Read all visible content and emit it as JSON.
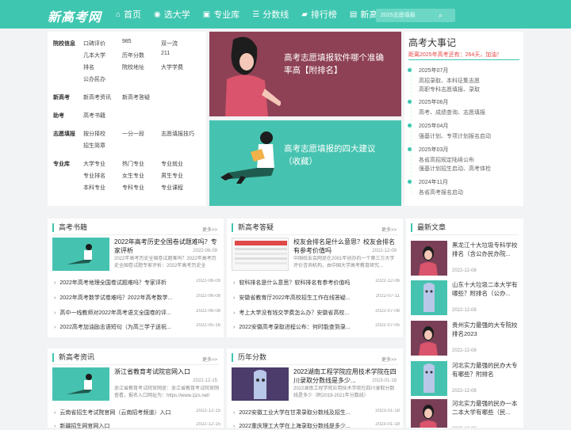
{
  "header": {
    "logo": "新高考网",
    "nav": [
      {
        "label": "首页",
        "icon": "home-icon",
        "glyph": "⌂"
      },
      {
        "label": "选大学",
        "icon": "compass-icon",
        "glyph": "◉"
      },
      {
        "label": "专业库",
        "icon": "briefcase-icon",
        "glyph": "▣"
      },
      {
        "label": "分数线",
        "icon": "list-icon",
        "glyph": "☰"
      },
      {
        "label": "排行榜",
        "icon": "chat-icon",
        "glyph": "▰"
      },
      {
        "label": "新高考资讯",
        "icon": "news-icon",
        "glyph": "▤"
      }
    ],
    "search_placeholder": "2025志愿填报",
    "accent": "#3ec6b0"
  },
  "categories": {
    "school_info": {
      "title": "院校信息",
      "items": [
        "口碑评价",
        "985",
        "双一流",
        "几本大学",
        "历年分数",
        "211",
        "排名",
        "院校地址",
        "大学学费",
        "公办民办"
      ]
    },
    "new_gaokao": {
      "title": "新高考",
      "items": [
        "新高考资讯",
        "新高考答疑"
      ]
    },
    "help": {
      "title": "助考",
      "items": [
        "高考书籍"
      ]
    },
    "volunteer": {
      "title": "志愿填报",
      "items": [
        "按分择校",
        "一分一段",
        "志愿填报技巧",
        "招生简章"
      ]
    },
    "major": {
      "title": "专业库",
      "items": [
        "大学专业",
        "热门专业",
        "专业就业",
        "专业排名",
        "女生专业",
        "男生专业",
        "本科专业",
        "专科专业",
        "专业课程"
      ]
    }
  },
  "banners": [
    {
      "title": "高考志愿填报软件哪个准确率高【附排名】"
    },
    {
      "title": "高考志愿填报的四大建议（收藏）"
    }
  ],
  "events": {
    "title": "高考大事记",
    "countdown": "距离2025年高考还有：264天，加油！",
    "items": [
      {
        "date": "2025年07月",
        "lines": [
          "高招录取、本科征集志愿",
          "高职专科志愿填报、录取"
        ]
      },
      {
        "date": "2025年06月",
        "lines": [
          "高考、成绩查询、志愿填报"
        ]
      },
      {
        "date": "2025年04月",
        "lines": [
          "强基计划、专项计划报名启动"
        ]
      },
      {
        "date": "2025年03月",
        "lines": [
          "各省高招规定陆续公布",
          "强基计划招生启动、高考体检"
        ]
      },
      {
        "date": "2024年11月",
        "lines": [
          "各省高考报名启动"
        ]
      }
    ]
  },
  "panels": {
    "books": {
      "title": "高考书籍",
      "more": "更多>>",
      "featured": {
        "title": "2022年高考历史全国卷试题难吗？专家评析",
        "desc": "2022年高考历史全国卷试题难吗？2022年高考历史全国卷试题专家评析：2022年高考历史全",
        "date": "2022-06-09"
      },
      "items": [
        {
          "title": "2022年高考地理全国卷试题难吗？专家评析",
          "date": "2022-06-09"
        },
        {
          "title": "2022年高考数学试卷难吗？2022年高考数学...",
          "date": "2022-06-08"
        },
        {
          "title": "高中一线教师对2022年高考语文全国卷的评...",
          "date": "2022-06-08"
        },
        {
          "title": "2022高考加油励志语短句（为高三学子送祝...",
          "date": "2022-05-16"
        }
      ]
    },
    "qa": {
      "title": "新高考答疑",
      "more": "更多>>",
      "featured": {
        "title": "校友会排名是什么意思？校友会排名有参考价值吗",
        "desc": "中国校友会网是在2001年创办的一个第三方大学评价咨询机构，由中国大学高考教育研究...",
        "date": "2022-12-09"
      },
      "items": [
        {
          "title": "软科排名是什么意思？软科排名有参考价值吗",
          "date": "2022-12-06"
        },
        {
          "title": "安徽省教育厅2022年高校招生工作在线答疑...",
          "date": "2022-07-11"
        },
        {
          "title": "考上大学没有钱交学费怎么办？安徽省高校...",
          "date": "2022-07-08"
        },
        {
          "title": "2022安徽高考录取进程公布：何时能查到录...",
          "date": "2022-07-05"
        }
      ]
    },
    "news": {
      "title": "新高考资讯",
      "more": "更多>>",
      "featured": {
        "title": "浙江省教育考试院官网入口",
        "desc": "浙江省教育考试院官网是：浙江省教育考试院官网查看，报名入口网址为：https://www.zjzs.net/",
        "date": "2022-12-15"
      },
      "items": [
        {
          "title": "云南省招生考试院官网（云南招考频道）入口",
          "date": "2022-12-15"
        },
        {
          "title": "新疆招生网官网入口",
          "date": "2022-12-15"
        }
      ]
    },
    "scores": {
      "title": "历年分数",
      "more": "更多>>",
      "featured": {
        "title": "2022湖南工程学院应用技术学院在四川录取分数线是多少...",
        "desc": "2022湖南工程学院应用技术学院在四川录取分数线是多少（附2019-2021年分数线）",
        "date": "2023-01-18"
      },
      "items": [
        {
          "title": "2022安徽工业大学在甘肃录取分数线及招生...",
          "date": "2023-01-18"
        },
        {
          "title": "2022重庆理工大学在上海录取分数线是多少...",
          "date": "2023-01-18"
        }
      ]
    },
    "latest": {
      "title": "最新文章",
      "items": [
        {
          "title": "黑龙江十大垃圾专科学校排名（含公办民办院...",
          "date": "2022-12-08"
        },
        {
          "title": "山东十大垃圾二本大学有哪些？附排名（公办...",
          "date": "2022-12-08"
        },
        {
          "title": "贵州实力最强的大专院校排名2023",
          "date": "2022-12-08"
        },
        {
          "title": "河北实力最强的民办大专有哪些？附排名",
          "date": "2022-12-08"
        },
        {
          "title": "河北实力最强的民办一本二本大学有哪些（民...",
          "date": "2022-12-08"
        }
      ]
    }
  }
}
